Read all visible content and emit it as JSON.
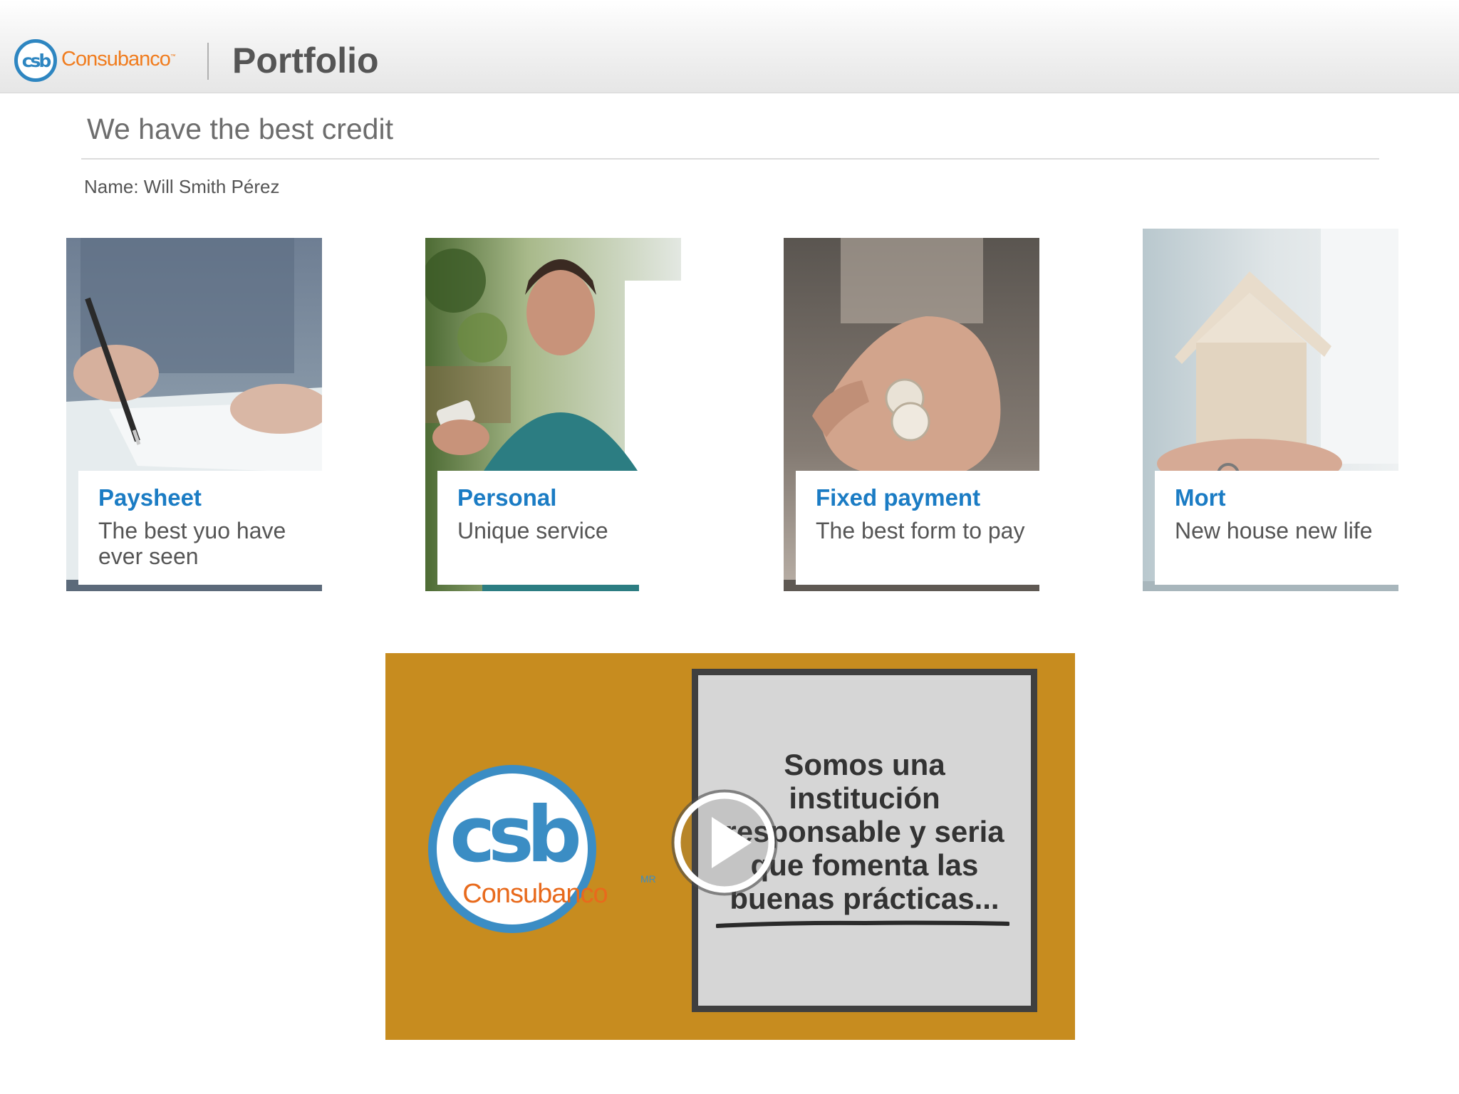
{
  "header": {
    "logo_badge": "csb",
    "logo_text": "Consubanco",
    "logo_mark": "™",
    "title": "Portfolio"
  },
  "subheader": {
    "tagline": "We have the best credit",
    "customer_name": "Name: Will Smith Pérez"
  },
  "cards": [
    {
      "title": "Paysheet",
      "desc": "The best yuo have ever seen",
      "image": "hand-signing-document-photo"
    },
    {
      "title": "Personal",
      "desc": "Unique service",
      "image": "woman-with-phone-photo"
    },
    {
      "title": "Fixed payment",
      "desc": "The best form to pay",
      "image": "hand-holding-coins-photo"
    },
    {
      "title": "Mort",
      "desc": "New house new life",
      "image": "hand-holding-house-photo"
    }
  ],
  "video": {
    "logo_badge": "csb",
    "logo_text": "Consubanco",
    "logo_mark": "MR",
    "board_text": "Somos una institución responsable y seria que fomenta las buenas prácticas...",
    "play_icon": "play-icon",
    "background_color": "#c78c1f"
  },
  "colors": {
    "accent_blue": "#1b7cc4",
    "brand_orange": "#f07c1e",
    "brand_blue": "#2e86c1"
  }
}
